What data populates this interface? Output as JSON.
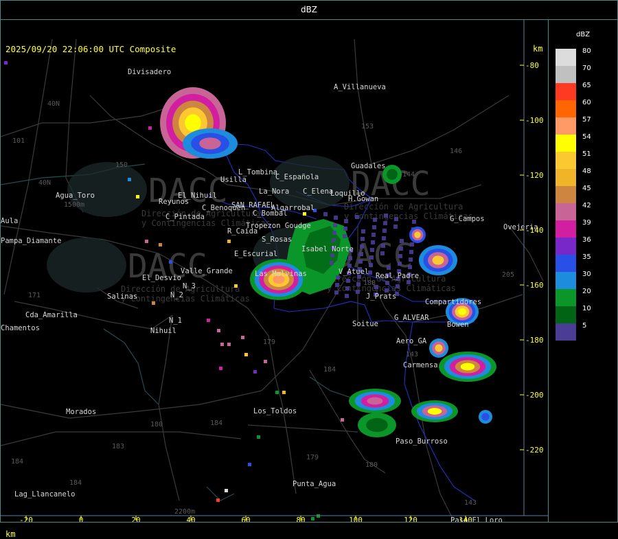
{
  "title": "dBZ",
  "subtitle": "2025/09/20 22:06:00 UTC Composite",
  "km_label": "km",
  "legend": {
    "unit": "dBZ",
    "entries": [
      {
        "value": "80",
        "color": "#dcdcdc"
      },
      {
        "value": "70",
        "color": "#c0c0c0"
      },
      {
        "value": "65",
        "color": "#ff3a22"
      },
      {
        "value": "60",
        "color": "#ff6600"
      },
      {
        "value": "57",
        "color": "#ff9a66"
      },
      {
        "value": "54",
        "color": "#ffff00"
      },
      {
        "value": "51",
        "color": "#fcc832"
      },
      {
        "value": "48",
        "color": "#f0b428"
      },
      {
        "value": "45",
        "color": "#cd853f"
      },
      {
        "value": "42",
        "color": "#c86496"
      },
      {
        "value": "39",
        "color": "#d21ea0"
      },
      {
        "value": "36",
        "color": "#7828c8"
      },
      {
        "value": "35",
        "color": "#2850e6"
      },
      {
        "value": "30",
        "color": "#1e8cdc"
      },
      {
        "value": "20",
        "color": "#0a9628"
      },
      {
        "value": "10",
        "color": "#006414"
      },
      {
        "value": "5",
        "color": "#4b3c96"
      }
    ]
  },
  "axes": {
    "x_ticks": [
      "-20",
      "0",
      "20",
      "40",
      "60",
      "80",
      "100",
      "120",
      "140"
    ],
    "y_ticks": [
      "-80",
      "-100",
      "-120",
      "-140",
      "-160",
      "-180",
      "-200",
      "-220"
    ]
  },
  "places": [
    {
      "name": "Divisadero"
    },
    {
      "name": "A_Villanueva"
    },
    {
      "name": "Guadales"
    },
    {
      "name": "L_Tombina"
    },
    {
      "name": "C_Española"
    },
    {
      "name": "Usilla"
    },
    {
      "name": "La_Nora"
    },
    {
      "name": "C_Elena"
    },
    {
      "name": "Loquillo"
    },
    {
      "name": "H.Gowan"
    },
    {
      "name": "Agua_Toro"
    },
    {
      "name": "Reyunos"
    },
    {
      "name": "El_Nihuil"
    },
    {
      "name": "C_Benoquen"
    },
    {
      "name": "SAN_RAFAEL"
    },
    {
      "name": "Algarrobal"
    },
    {
      "name": "C_Pintada"
    },
    {
      "name": "C_Bombal"
    },
    {
      "name": "Tropezon Goudge"
    },
    {
      "name": "G_Campos"
    },
    {
      "name": "Aula"
    },
    {
      "name": "Pampa_Diamante"
    },
    {
      "name": "R_Caida"
    },
    {
      "name": "S_Rosas"
    },
    {
      "name": "Isabel Norte"
    },
    {
      "name": "E_Escurial"
    },
    {
      "name": "Valle_Grande"
    },
    {
      "name": "Las Malvinas"
    },
    {
      "name": "V_Atuel"
    },
    {
      "name": "Real_Padre"
    },
    {
      "name": "El_Desvio"
    },
    {
      "name": "N_3"
    },
    {
      "name": "N_2"
    },
    {
      "name": "Salinas"
    },
    {
      "name": "J_Prats"
    },
    {
      "name": "Compartidores"
    },
    {
      "name": "Cda_Amarilla"
    },
    {
      "name": "Nihuil"
    },
    {
      "name": "N_1"
    },
    {
      "name": "G_ALVEAR"
    },
    {
      "name": "Soitue"
    },
    {
      "name": "Bowen"
    },
    {
      "name": "Chamentos"
    },
    {
      "name": "Aero_GA"
    },
    {
      "name": "Carmensa"
    },
    {
      "name": "Morados"
    },
    {
      "name": "Los_Toldos"
    },
    {
      "name": "Paso_Burroso"
    },
    {
      "name": "Punta_Agua"
    },
    {
      "name": "Lag_Llancanelo"
    },
    {
      "name": "Paso_El_Loro"
    },
    {
      "name": "Ovejeria"
    }
  ],
  "route_labels": [
    "153",
    "146",
    "144",
    "143",
    "150",
    "101",
    "40N",
    "40N",
    "188",
    "205",
    "179",
    "184",
    "180",
    "184",
    "183",
    "184",
    "179",
    "180",
    "143",
    "171",
    "1500m",
    "2200m",
    "184"
  ],
  "watermark": {
    "brand": "DACC",
    "line1": "Dirección de Agricultura",
    "line2": "y Contingencias Climáticas"
  }
}
